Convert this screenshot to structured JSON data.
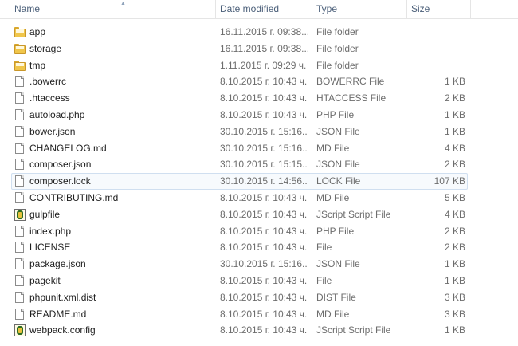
{
  "columns": {
    "name": "Name",
    "date_modified": "Date modified",
    "type": "Type",
    "size": "Size"
  },
  "files": [
    {
      "name": "app",
      "date": "16.11.2015 г. 09:38...",
      "type": "File folder",
      "size": "",
      "icon": "folder-icon"
    },
    {
      "name": "storage",
      "date": "16.11.2015 г. 09:38...",
      "type": "File folder",
      "size": "",
      "icon": "folder-icon"
    },
    {
      "name": "tmp",
      "date": "1.11.2015 г. 09:29 ч.",
      "type": "File folder",
      "size": "",
      "icon": "folder-icon"
    },
    {
      "name": ".bowerrc",
      "date": "8.10.2015 г. 10:43 ч.",
      "type": "BOWERRC File",
      "size": "1 KB",
      "icon": "file-icon"
    },
    {
      "name": ".htaccess",
      "date": "8.10.2015 г. 10:43 ч.",
      "type": "HTACCESS File",
      "size": "2 KB",
      "icon": "file-icon"
    },
    {
      "name": "autoload.php",
      "date": "8.10.2015 г. 10:43 ч.",
      "type": "PHP File",
      "size": "1 KB",
      "icon": "file-icon"
    },
    {
      "name": "bower.json",
      "date": "30.10.2015 г. 15:16...",
      "type": "JSON File",
      "size": "1 KB",
      "icon": "file-icon"
    },
    {
      "name": "CHANGELOG.md",
      "date": "30.10.2015 г. 15:16...",
      "type": "MD File",
      "size": "4 KB",
      "icon": "file-icon"
    },
    {
      "name": "composer.json",
      "date": "30.10.2015 г. 15:15...",
      "type": "JSON File",
      "size": "2 KB",
      "icon": "file-icon"
    },
    {
      "name": "composer.lock",
      "date": "30.10.2015 г. 14:56...",
      "type": "LOCK File",
      "size": "107 KB",
      "icon": "file-icon"
    },
    {
      "name": "CONTRIBUTING.md",
      "date": "8.10.2015 г. 10:43 ч.",
      "type": "MD File",
      "size": "5 KB",
      "icon": "file-icon"
    },
    {
      "name": "gulpfile",
      "date": "8.10.2015 г. 10:43 ч.",
      "type": "JScript Script File",
      "size": "4 KB",
      "icon": "script-icon"
    },
    {
      "name": "index.php",
      "date": "8.10.2015 г. 10:43 ч.",
      "type": "PHP File",
      "size": "2 KB",
      "icon": "file-icon"
    },
    {
      "name": "LICENSE",
      "date": "8.10.2015 г. 10:43 ч.",
      "type": "File",
      "size": "2 KB",
      "icon": "file-icon"
    },
    {
      "name": "package.json",
      "date": "30.10.2015 г. 15:16...",
      "type": "JSON File",
      "size": "1 KB",
      "icon": "file-icon"
    },
    {
      "name": "pagekit",
      "date": "8.10.2015 г. 10:43 ч.",
      "type": "File",
      "size": "1 KB",
      "icon": "file-icon"
    },
    {
      "name": "phpunit.xml.dist",
      "date": "8.10.2015 г. 10:43 ч.",
      "type": "DIST File",
      "size": "3 KB",
      "icon": "file-icon"
    },
    {
      "name": "README.md",
      "date": "8.10.2015 г. 10:43 ч.",
      "type": "MD File",
      "size": "3 KB",
      "icon": "file-icon"
    },
    {
      "name": "webpack.config",
      "date": "8.10.2015 г. 10:43 ч.",
      "type": "JScript Script File",
      "size": "1 KB",
      "icon": "script-icon"
    }
  ],
  "hovered_file": "composer.lock",
  "colors": {
    "header_text": "#4c607a",
    "detail_text": "#6d6d6d",
    "hover_border": "#d0dff0",
    "folder": "#f0c64b"
  }
}
